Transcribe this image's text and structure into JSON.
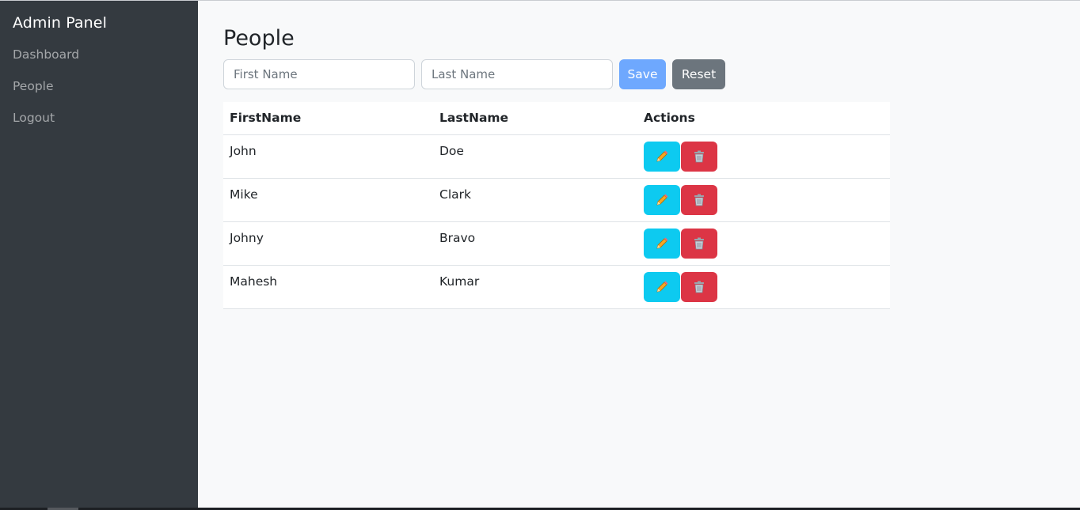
{
  "sidebar": {
    "brand": "Admin Panel",
    "items": [
      {
        "label": "Dashboard"
      },
      {
        "label": "People"
      },
      {
        "label": "Logout"
      }
    ]
  },
  "main": {
    "title": "People",
    "form": {
      "first_name_placeholder": "First Name",
      "last_name_placeholder": "Last Name",
      "first_name_value": "",
      "last_name_value": "",
      "save_label": "Save",
      "reset_label": "Reset"
    },
    "table": {
      "headers": [
        "FirstName",
        "LastName",
        "Actions"
      ],
      "rows": [
        {
          "first": "John",
          "last": "Doe"
        },
        {
          "first": "Mike",
          "last": "Clark"
        },
        {
          "first": "Johny",
          "last": "Bravo"
        },
        {
          "first": "Mahesh",
          "last": "Kumar"
        }
      ],
      "action_icons": [
        "pencil-icon",
        "trash-icon"
      ]
    }
  },
  "colors": {
    "sidebar_bg": "#343a40",
    "page_bg": "#f8f9fa",
    "save_button": "#6ea8fe",
    "reset_button": "#6c757d",
    "edit_button": "#0dcaf0",
    "delete_button": "#dc3545"
  }
}
